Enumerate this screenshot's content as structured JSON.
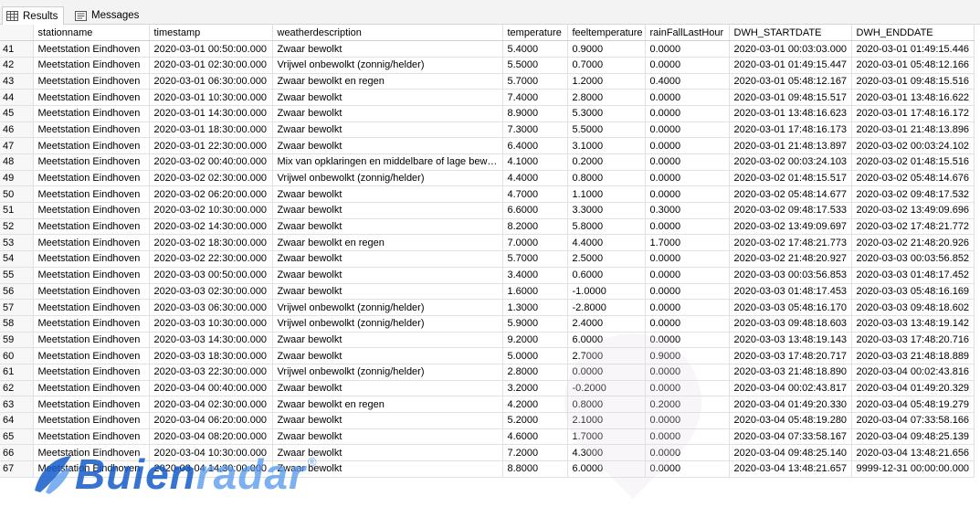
{
  "tabs": [
    {
      "label": "Results",
      "icon": "grid-icon",
      "active": true
    },
    {
      "label": "Messages",
      "icon": "messages-icon",
      "active": false
    }
  ],
  "columns": [
    "",
    "stationname",
    "timestamp",
    "weatherdescription",
    "temperature",
    "feeltemperature",
    "rainFallLastHour",
    "DWH_STARTDATE",
    "DWH_ENDDATE"
  ],
  "rows": [
    [
      "41",
      "Meetstation Eindhoven",
      "2020-03-01 00:50:00.000",
      "Zwaar bewolkt",
      "5.4000",
      "0.9000",
      "0.0000",
      "2020-03-01 00:03:03.000",
      "2020-03-01 01:49:15.446"
    ],
    [
      "42",
      "Meetstation Eindhoven",
      "2020-03-01 02:30:00.000",
      "Vrijwel onbewolkt (zonnig/helder)",
      "5.5000",
      "0.7000",
      "0.0000",
      "2020-03-01 01:49:15.447",
      "2020-03-01 05:48:12.166"
    ],
    [
      "43",
      "Meetstation Eindhoven",
      "2020-03-01 06:30:00.000",
      "Zwaar bewolkt en regen",
      "5.7000",
      "1.2000",
      "0.4000",
      "2020-03-01 05:48:12.167",
      "2020-03-01 09:48:15.516"
    ],
    [
      "44",
      "Meetstation Eindhoven",
      "2020-03-01 10:30:00.000",
      "Zwaar bewolkt",
      "7.4000",
      "2.8000",
      "0.0000",
      "2020-03-01 09:48:15.517",
      "2020-03-01 13:48:16.622"
    ],
    [
      "45",
      "Meetstation Eindhoven",
      "2020-03-01 14:30:00.000",
      "Zwaar bewolkt",
      "8.9000",
      "5.3000",
      "0.0000",
      "2020-03-01 13:48:16.623",
      "2020-03-01 17:48:16.172"
    ],
    [
      "46",
      "Meetstation Eindhoven",
      "2020-03-01 18:30:00.000",
      "Zwaar bewolkt",
      "7.3000",
      "5.5000",
      "0.0000",
      "2020-03-01 17:48:16.173",
      "2020-03-01 21:48:13.896"
    ],
    [
      "47",
      "Meetstation Eindhoven",
      "2020-03-01 22:30:00.000",
      "Zwaar bewolkt",
      "6.4000",
      "3.1000",
      "0.0000",
      "2020-03-01 21:48:13.897",
      "2020-03-02 00:03:24.102"
    ],
    [
      "48",
      "Meetstation Eindhoven",
      "2020-03-02 00:40:00.000",
      "Mix van opklaringen en middelbare of lage bewolk...",
      "4.1000",
      "0.2000",
      "0.0000",
      "2020-03-02 00:03:24.103",
      "2020-03-02 01:48:15.516"
    ],
    [
      "49",
      "Meetstation Eindhoven",
      "2020-03-02 02:30:00.000",
      "Vrijwel onbewolkt (zonnig/helder)",
      "4.4000",
      "0.8000",
      "0.0000",
      "2020-03-02 01:48:15.517",
      "2020-03-02 05:48:14.676"
    ],
    [
      "50",
      "Meetstation Eindhoven",
      "2020-03-02 06:20:00.000",
      "Zwaar bewolkt",
      "4.7000",
      "1.1000",
      "0.0000",
      "2020-03-02 05:48:14.677",
      "2020-03-02 09:48:17.532"
    ],
    [
      "51",
      "Meetstation Eindhoven",
      "2020-03-02 10:30:00.000",
      "Zwaar bewolkt",
      "6.6000",
      "3.3000",
      "0.3000",
      "2020-03-02 09:48:17.533",
      "2020-03-02 13:49:09.696"
    ],
    [
      "52",
      "Meetstation Eindhoven",
      "2020-03-02 14:30:00.000",
      "Zwaar bewolkt",
      "8.2000",
      "5.8000",
      "0.0000",
      "2020-03-02 13:49:09.697",
      "2020-03-02 17:48:21.772"
    ],
    [
      "53",
      "Meetstation Eindhoven",
      "2020-03-02 18:30:00.000",
      "Zwaar bewolkt en regen",
      "7.0000",
      "4.4000",
      "1.7000",
      "2020-03-02 17:48:21.773",
      "2020-03-02 21:48:20.926"
    ],
    [
      "54",
      "Meetstation Eindhoven",
      "2020-03-02 22:30:00.000",
      "Zwaar bewolkt",
      "5.7000",
      "2.5000",
      "0.0000",
      "2020-03-02 21:48:20.927",
      "2020-03-03 00:03:56.852"
    ],
    [
      "55",
      "Meetstation Eindhoven",
      "2020-03-03 00:50:00.000",
      "Zwaar bewolkt",
      "3.4000",
      "0.6000",
      "0.0000",
      "2020-03-03 00:03:56.853",
      "2020-03-03 01:48:17.452"
    ],
    [
      "56",
      "Meetstation Eindhoven",
      "2020-03-03 02:30:00.000",
      "Zwaar bewolkt",
      "1.6000",
      "-1.0000",
      "0.0000",
      "2020-03-03 01:48:17.453",
      "2020-03-03 05:48:16.169"
    ],
    [
      "57",
      "Meetstation Eindhoven",
      "2020-03-03 06:30:00.000",
      "Vrijwel onbewolkt (zonnig/helder)",
      "1.3000",
      "-2.8000",
      "0.0000",
      "2020-03-03 05:48:16.170",
      "2020-03-03 09:48:18.602"
    ],
    [
      "58",
      "Meetstation Eindhoven",
      "2020-03-03 10:30:00.000",
      "Vrijwel onbewolkt (zonnig/helder)",
      "5.9000",
      "2.4000",
      "0.0000",
      "2020-03-03 09:48:18.603",
      "2020-03-03 13:48:19.142"
    ],
    [
      "59",
      "Meetstation Eindhoven",
      "2020-03-03 14:30:00.000",
      "Zwaar bewolkt",
      "9.2000",
      "6.0000",
      "0.0000",
      "2020-03-03 13:48:19.143",
      "2020-03-03 17:48:20.716"
    ],
    [
      "60",
      "Meetstation Eindhoven",
      "2020-03-03 18:30:00.000",
      "Zwaar bewolkt",
      "5.0000",
      "2.7000",
      "0.9000",
      "2020-03-03 17:48:20.717",
      "2020-03-03 21:48:18.889"
    ],
    [
      "61",
      "Meetstation Eindhoven",
      "2020-03-03 22:30:00.000",
      "Vrijwel onbewolkt (zonnig/helder)",
      "2.8000",
      "0.0000",
      "0.0000",
      "2020-03-03 21:48:18.890",
      "2020-03-04 00:02:43.816"
    ],
    [
      "62",
      "Meetstation Eindhoven",
      "2020-03-04 00:40:00.000",
      "Zwaar bewolkt",
      "3.2000",
      "-0.2000",
      "0.0000",
      "2020-03-04 00:02:43.817",
      "2020-03-04 01:49:20.329"
    ],
    [
      "63",
      "Meetstation Eindhoven",
      "2020-03-04 02:30:00.000",
      "Zwaar bewolkt en regen",
      "4.2000",
      "0.8000",
      "0.2000",
      "2020-03-04 01:49:20.330",
      "2020-03-04 05:48:19.279"
    ],
    [
      "64",
      "Meetstation Eindhoven",
      "2020-03-04 06:20:00.000",
      "Zwaar bewolkt",
      "5.2000",
      "2.1000",
      "0.0000",
      "2020-03-04 05:48:19.280",
      "2020-03-04 07:33:58.166"
    ],
    [
      "65",
      "Meetstation Eindhoven",
      "2020-03-04 08:20:00.000",
      "Zwaar bewolkt",
      "4.6000",
      "1.7000",
      "0.0000",
      "2020-03-04 07:33:58.167",
      "2020-03-04 09:48:25.139"
    ],
    [
      "66",
      "Meetstation Eindhoven",
      "2020-03-04 10:30:00.000",
      "Zwaar bewolkt",
      "7.2000",
      "4.3000",
      "0.0000",
      "2020-03-04 09:48:25.140",
      "2020-03-04 13:48:21.656"
    ],
    [
      "67",
      "Meetstation Eindhoven",
      "2020-03-04 14:30:00.000",
      "Zwaar bewolkt",
      "8.8000",
      "6.0000",
      "0.0000",
      "2020-03-04 13:48:21.657",
      "9999-12-31 00:00:00.000"
    ]
  ],
  "watermark": {
    "brand_part1": "Buien",
    "brand_part2": "radar",
    "registered": "®",
    "icon": "buienradar-logo-icon"
  }
}
